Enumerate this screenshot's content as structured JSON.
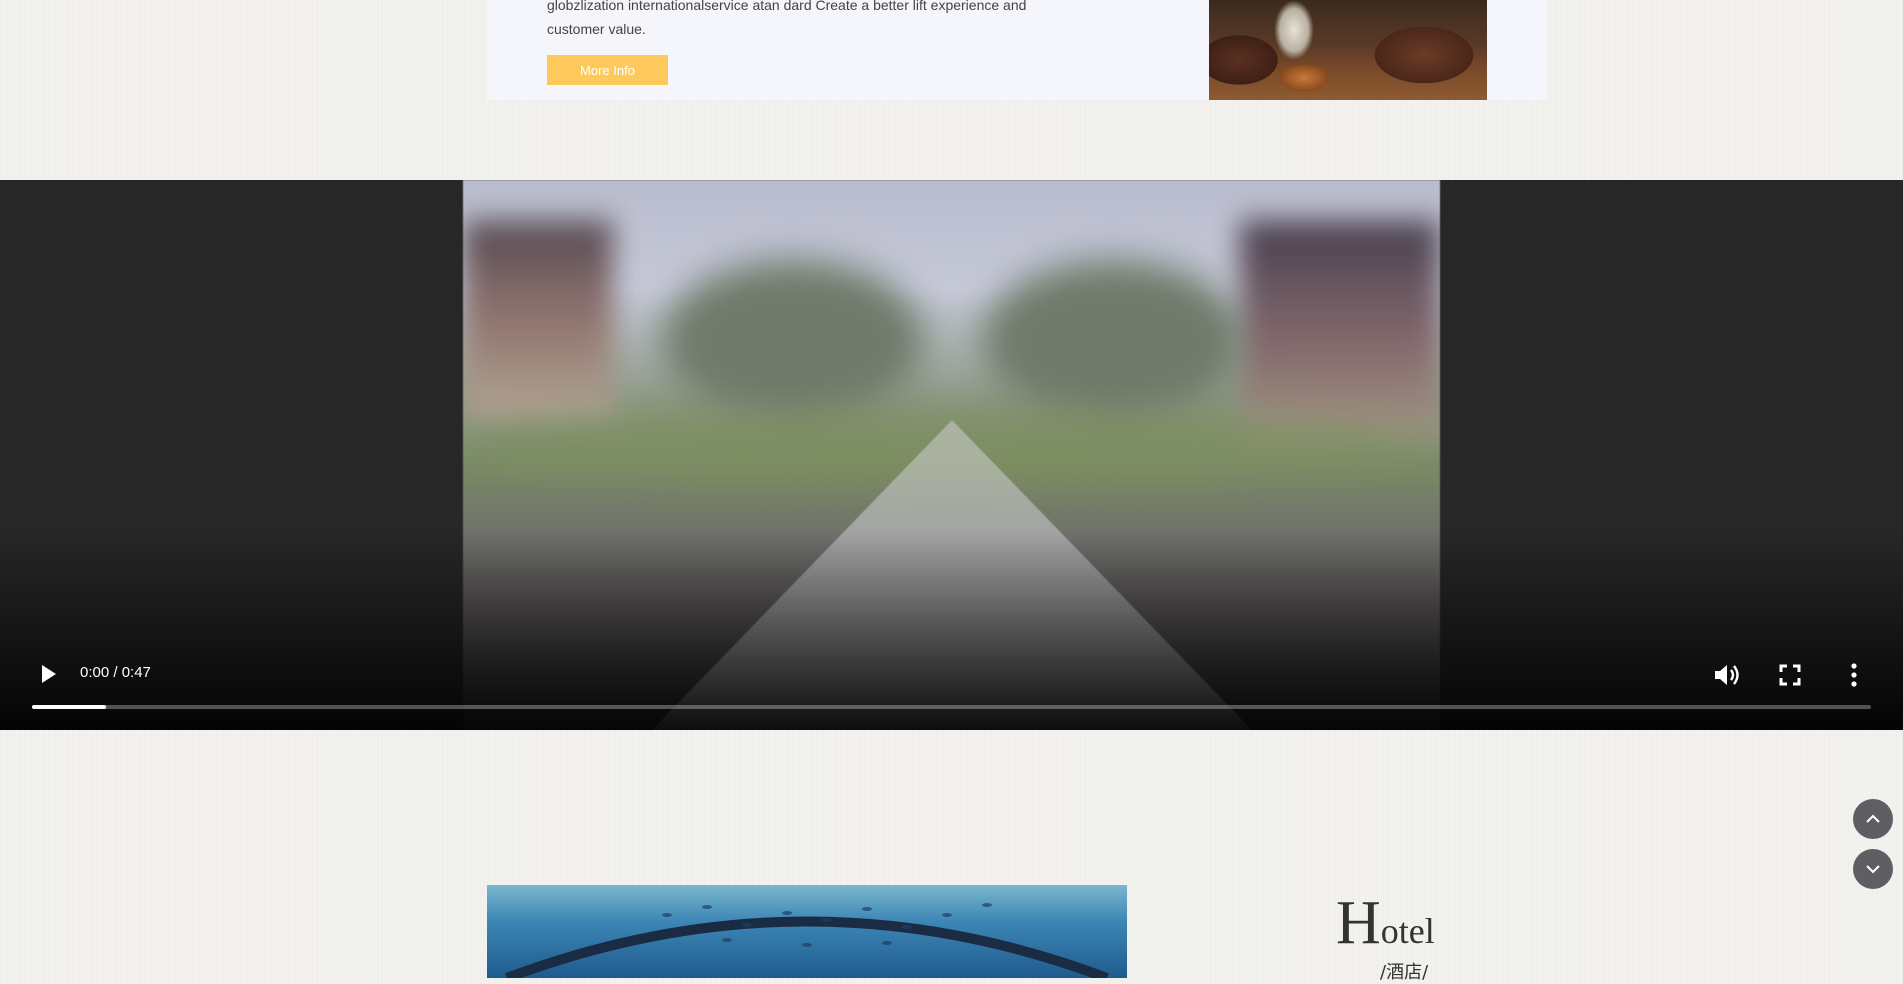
{
  "info": {
    "text_line1": "globzlization internationalservice atan dard Create a better lift experience and",
    "text_line2": "customer value.",
    "more_label": "More Info"
  },
  "video": {
    "time": "0:00 / 0:47",
    "progress": 0.04,
    "controls": {
      "play_icon": "play-icon",
      "volume_icon": "volume-icon",
      "fullscreen_icon": "fullscreen-icon",
      "more_icon": "more-vertical-icon"
    }
  },
  "scroll": {
    "up_icon": "chevron-up-icon",
    "down_icon": "chevron-down-icon"
  },
  "hotel": {
    "title_first": "H",
    "title_rest": "otel",
    "subtitle": "/酒店/"
  },
  "colors": {
    "accent": "#fdc95c",
    "player_bg": "#272727",
    "scroll_btn": "#5d5f63"
  }
}
